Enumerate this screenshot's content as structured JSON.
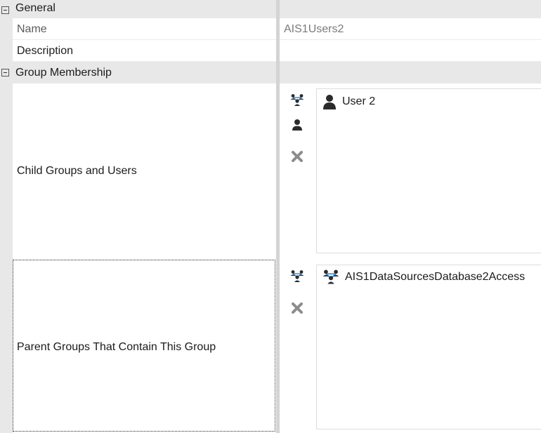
{
  "categories": {
    "general": "General",
    "group_membership": "Group Membership"
  },
  "properties": {
    "name": {
      "label": "Name",
      "value": "AIS1Users2"
    },
    "description": {
      "label": "Description",
      "value": ""
    },
    "child_groups_and_users": {
      "label": "Child Groups and Users",
      "toolbar_icons": [
        "add-group-icon",
        "add-user-icon",
        "remove-icon"
      ],
      "items": [
        {
          "text": "User 2",
          "icon": "user-icon"
        }
      ]
    },
    "parent_groups": {
      "label": "Parent Groups That Contain This Group",
      "toolbar_icons": [
        "add-group-icon",
        "remove-icon"
      ],
      "items": [
        {
          "text": "AIS1DataSourcesDatabase2Access",
          "icon": "group-icon"
        }
      ]
    }
  },
  "colors": {
    "gutter": "#e8e8e8",
    "splitter": "#d4d4d4",
    "group_icon_accent": "#3a8fd6",
    "icon_dark": "#2b2b2b",
    "remove_icon": "#8c8c8c"
  }
}
